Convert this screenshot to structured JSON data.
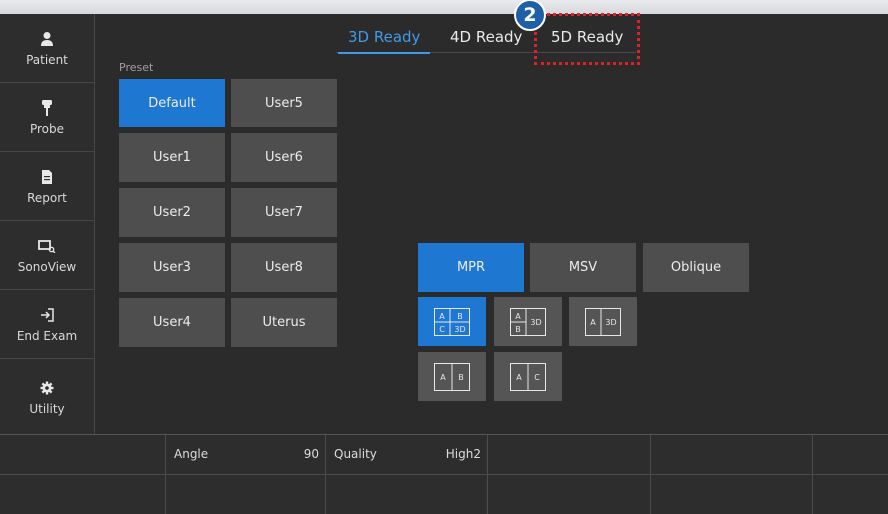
{
  "sidebar": {
    "items": [
      {
        "label": "Patient",
        "icon": "person-icon"
      },
      {
        "label": "Probe",
        "icon": "probe-icon"
      },
      {
        "label": "Report",
        "icon": "document-icon"
      },
      {
        "label": "SonoView",
        "icon": "sonoview-icon"
      },
      {
        "label": "End Exam",
        "icon": "exit-icon"
      },
      {
        "label": "Utility",
        "icon": "gear-icon"
      }
    ]
  },
  "tabs": [
    {
      "label": "3D Ready",
      "active": true
    },
    {
      "label": "4D Ready",
      "active": false
    },
    {
      "label": "5D Ready",
      "active": false
    }
  ],
  "preset": {
    "label": "Preset",
    "buttons": [
      "Default",
      "User5",
      "User1",
      "User6",
      "User2",
      "User7",
      "User3",
      "User8",
      "User4",
      "Uterus"
    ],
    "selected": "Default"
  },
  "view_modes": {
    "buttons": [
      "MPR",
      "MSV",
      "Oblique"
    ],
    "selected": "MPR"
  },
  "layouts": {
    "options": [
      {
        "cells": [
          "A",
          "B",
          "C",
          "3D"
        ],
        "selected": true
      },
      {
        "cells": [
          "A",
          "B",
          "3D"
        ],
        "selected": false
      },
      {
        "cells": [
          "A",
          "3D"
        ],
        "selected": false
      },
      {
        "cells": [
          "A",
          "B"
        ],
        "selected": false
      },
      {
        "cells": [
          "A",
          "C"
        ],
        "selected": false
      }
    ]
  },
  "bottom": {
    "angle_label": "Angle",
    "angle_value": "90",
    "quality_label": "Quality",
    "quality_value": "High2"
  },
  "callout": {
    "number": "2"
  },
  "colors": {
    "accent": "#1e78d2",
    "tab_active": "#3f9be8",
    "callout": "#e0202a"
  }
}
